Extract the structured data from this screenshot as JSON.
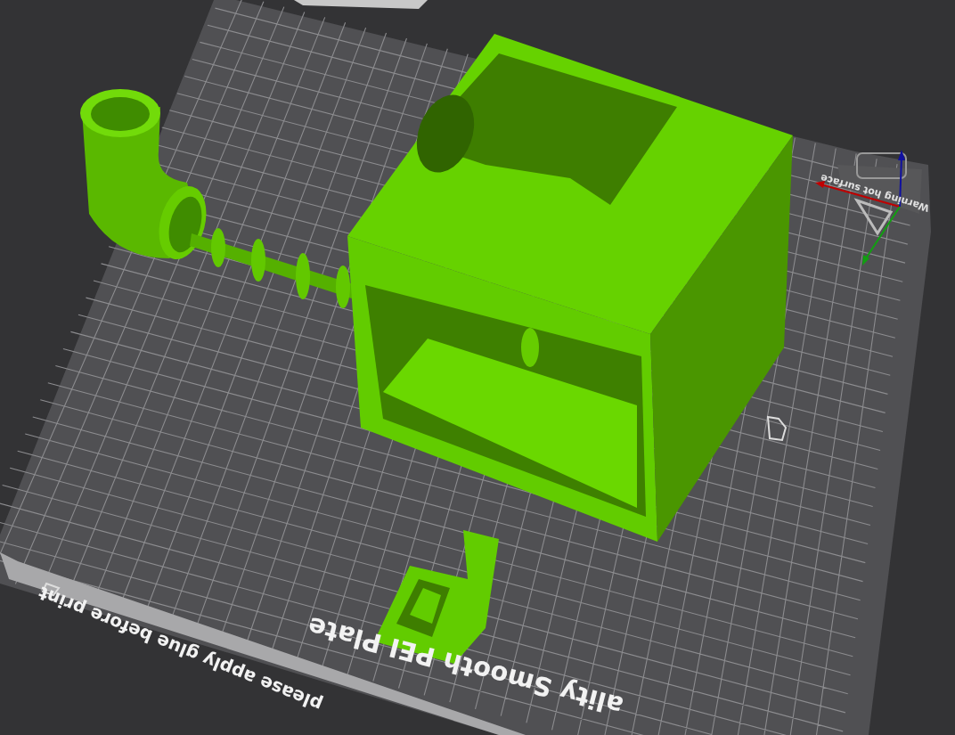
{
  "viewport": {
    "plate": {
      "texts": [
        {
          "kind": "title",
          "text": "ality Smooth PEI Plate"
        },
        {
          "kind": "note",
          "text": "please apply glue before print"
        },
        {
          "kind": "warning",
          "text": "Warning hot surface"
        }
      ]
    }
  }
}
